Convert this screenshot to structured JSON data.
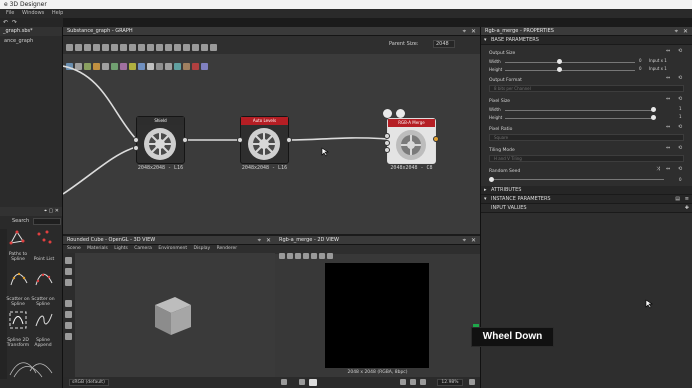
{
  "app": {
    "title": "e 3D Designer",
    "menu": [
      "File",
      "Windows",
      "Help"
    ]
  },
  "explorer": {
    "tab": "_graph.sbs*",
    "item": "ance_graph"
  },
  "graph": {
    "title": "Substance_graph - GRAPH",
    "parent_size_label": "Parent Size:",
    "parent_size_value": "2048",
    "nodes": [
      {
        "title": "Shield",
        "caption": "2048x2048 - L16",
        "color": "#2d2d2d",
        "outputs": "gray"
      },
      {
        "title": "Auto Levels",
        "caption": "2048x2048 - L16",
        "color": "#b51e24",
        "outputs": "gray"
      },
      {
        "title": "RGB-A Merge",
        "caption": "2048x2048 - C8",
        "color": "#b51e24",
        "outputs": "orange"
      }
    ]
  },
  "library": {
    "search_label": "Search",
    "items": [
      {
        "label": "Paths to Spline"
      },
      {
        "label": "Point List"
      },
      {
        "label": "Scatter on Spline"
      },
      {
        "label": "Scatter on Spline"
      },
      {
        "label": "Spline 2D Transform"
      },
      {
        "label": "Spline Append"
      }
    ]
  },
  "view3d": {
    "title": "Rounded Cube - OpenGL - 3D VIEW",
    "menu": [
      "Scene",
      "Materials",
      "Lights",
      "Camera",
      "Environment",
      "Display",
      "Renderer"
    ],
    "color_space": "sRGB (default)"
  },
  "view2d": {
    "title": "Rgb-a_merge - 2D VIEW",
    "status": "2048 x 2048 (RGBA, 8bpc)",
    "zoom": "12.98%"
  },
  "properties": {
    "title": "Rgb-a_merge - PROPERTIES",
    "sections": {
      "base": "BASE PARAMETERS",
      "attributes": "ATTRIBUTES",
      "instance": "INSTANCE PARAMETERS",
      "input_values": "INPUT VALUES"
    },
    "output_size": {
      "label": "Output Size",
      "width_label": "Width",
      "height_label": "Height",
      "width_value": "0",
      "height_value": "0",
      "width_mode": "Input x 1",
      "height_mode": "Input x 1"
    },
    "output_format": {
      "label": "Output Format",
      "value": "8 bits per Channel"
    },
    "pixel_size": {
      "label": "Pixel Size",
      "width_label": "Width",
      "height_label": "Height",
      "width_value": "1",
      "height_value": "1"
    },
    "pixel_ratio": {
      "label": "Pixel Ratio",
      "value": "Square"
    },
    "tiling_mode": {
      "label": "Tiling Mode",
      "value": "H and V Tiling"
    },
    "random_seed": {
      "label": "Random Seed",
      "value": "0"
    }
  },
  "overlay": {
    "key_hint": "Wheel Down"
  },
  "colors": {
    "node_red": "#b51e24",
    "output_port": "#e0a030",
    "accent_green": "#1ea84a"
  }
}
